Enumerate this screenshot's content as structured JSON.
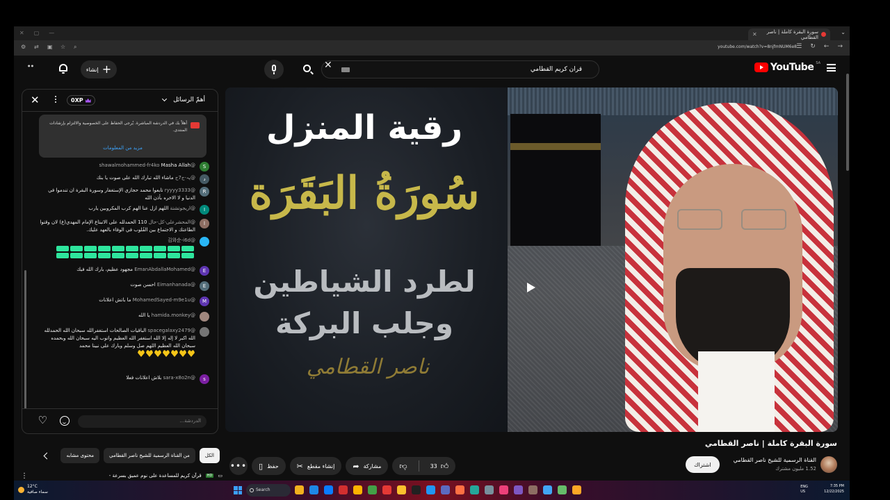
{
  "browser": {
    "tab_title": "سورة البقرة كاملة | ناصر القطامي",
    "url": "youtube.com/watch?v=8njfmNUM6e8"
  },
  "header": {
    "logo_text": "YouTube",
    "logo_region": "SA",
    "search_query": "قران كريم القطامي",
    "create_label": "إنشاء"
  },
  "chat": {
    "title": "أهمّ الرسائل",
    "xp_label": "0XP",
    "notice_text": "أهلاً بك في الدردشة المباشرة. يُرجى الحفاظ على الخصوصية والالتزام بإرشادات المنتدى.",
    "notice_link": "مزيد من المعلومات",
    "input_placeholder": "الدردشة...",
    "messages": [
      {
        "author": "@shawalmohammed-fr4ko",
        "text": "Masha Allah",
        "initial": "S",
        "color": "#2e7d32"
      },
      {
        "author": "@پہ-ج7ج",
        "text": "ماشاء الله تبارك الله على صوت يا بنك",
        "initial": "د",
        "color": "#455a64"
      },
      {
        "author": "@ryyyy3333",
        "text": "تابعوا محمد حجازي الإستغفار وسورة البقرة ان تندموا في الدنيا و لا الاخره بأذن الله",
        "initial": "R",
        "color": "#546e7a"
      },
      {
        "author": "@اريجوتشتة",
        "text": "اللهم ازل عنا الهم كرب المكروبين يارب",
        "initial": "I",
        "color": "#00897b"
      },
      {
        "author": "@المحشرعلى-كل-حال",
        "text": "110 الحمدلله على الاتبتاع الإمام المهدي(ع) لان وقتوا الطاعتك و الاجتماع بين القُلوب في الوفاء بالعهد عليك.",
        "initial": "ا",
        "color": "#8d6e63"
      },
      {
        "author": "@김와순-i6d",
        "text": "",
        "initial": "",
        "color": "#29b6f6"
      },
      {
        "author": "@EmanAbdallaMohamed",
        "text": "مجهود عظيم، بارك الله فيك",
        "initial": "E",
        "color": "#5e35b1"
      },
      {
        "author": "@Eimanhanada",
        "text": "احسن صوت",
        "initial": "E",
        "color": "#546e7a"
      },
      {
        "author": "@MohamedSayed-m9e1u",
        "text": "ما باتش اعلانات",
        "initial": "M",
        "color": "#5e35b1"
      },
      {
        "author": "@hamida.monkey",
        "text": "يا الله",
        "initial": "",
        "color": "#a1887f"
      },
      {
        "author": "@spacegalaxy2479",
        "text": "الباقيات الصالحات استغفرالله سبحان الله الحمدلله الله اكبر لا إله إلا الله استغفر الله العظيم واتوب اليه سبحان الله وبحمده سبحان الله العظيم اللهم صل وسلم وبارك على نبينا محمد",
        "initial": "",
        "color": "#757575"
      },
      {
        "author": "@sara-x8o2n",
        "text": "بلاش اعلانات فعلا",
        "initial": "s",
        "color": "#7b1fa2"
      }
    ]
  },
  "video": {
    "overlay_title": "رقية المنزل",
    "overlay_surah": "سُورَةُ البَقَرَة",
    "overlay_line1": "لطرد الشياطين",
    "overlay_line2": "وجلب البركة",
    "overlay_signature": "ناصر القطامي",
    "title": "سورة البقرة كاملة | ناصر القطامي",
    "channel_name": "القناة الرسمية للشيخ ناصر القطامي",
    "subscribers": "1.52 مليون مشترك",
    "subscribe_label": "اشتراك",
    "like_count": "33",
    "share_label": "مشاركة",
    "clip_label": "إنشاء مقطع",
    "save_label": "حفظ"
  },
  "chips": [
    "الكل",
    "من القناة الرسمية للشيخ ناصر القطامي",
    "محتوى مشابه"
  ],
  "recommendation": {
    "title": "قرآن كريم للمساعدة على نوم عميق بسرعة -",
    "tag": "HD"
  },
  "taskbar": {
    "weather_temp": "12°C",
    "weather_desc": "سماء صافية",
    "search_label": "Search",
    "lang": "ENG",
    "lang_region": "US",
    "time": "7:35 PM",
    "date": "12/22/2025"
  }
}
